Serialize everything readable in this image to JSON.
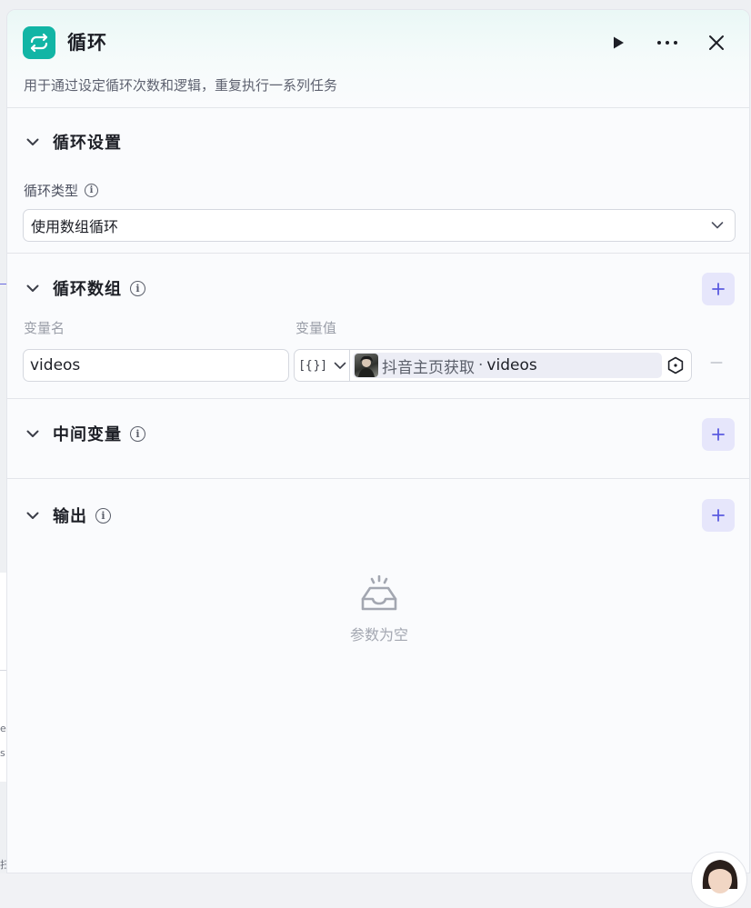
{
  "node": {
    "title": "循环",
    "description": "用于通过设定循环次数和逻辑，重复执行一系列任务",
    "icon": "loop-icon",
    "accent": "#12b5a5"
  },
  "header_actions": [
    {
      "name": "run-icon"
    },
    {
      "name": "more-icon"
    },
    {
      "name": "close-icon"
    }
  ],
  "loop_settings": {
    "title": "循环设置",
    "type_label": "循环类型",
    "type_value": "使用数组循环"
  },
  "loop_array": {
    "title": "循环数组",
    "col_name": "变量名",
    "col_value": "变量值",
    "rows": [
      {
        "name": "videos",
        "type_glyph": "[{}]",
        "source": "抖音主页获取",
        "separator": "·",
        "variable": "videos"
      }
    ],
    "remove_glyph": "—"
  },
  "intermediate": {
    "title": "中间变量"
  },
  "output": {
    "title": "输出",
    "empty_text": "参数为空"
  },
  "background": {
    "fragments": [
      "e",
      "s",
      "扫"
    ]
  },
  "colors": {
    "add_button_bg": "#e6e6fb",
    "add_button_fg": "#5b5be0"
  }
}
